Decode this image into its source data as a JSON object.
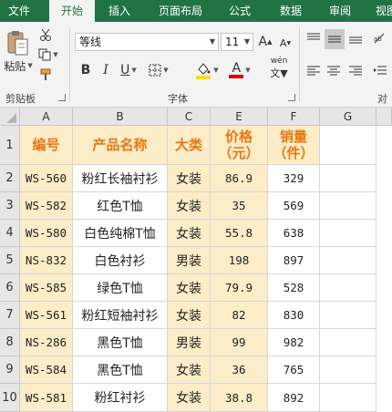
{
  "tabs": [
    "文件",
    "开始",
    "插入",
    "页面布局",
    "公式",
    "数据",
    "审阅",
    "视图"
  ],
  "active_tab": "开始",
  "ribbon": {
    "clipboard": {
      "paste_label": "粘贴",
      "group_label": "剪贴板"
    },
    "font": {
      "font_name": "等线",
      "font_size": "11",
      "grow_label": "A",
      "shrink_label": "A",
      "bold": "B",
      "italic": "I",
      "underline": "U",
      "font_color_label": "A",
      "phonetic_label": "wén",
      "group_label": "字体"
    },
    "alignment": {
      "group_label": "对"
    }
  },
  "columns": [
    "A",
    "B",
    "C",
    "E",
    "F",
    "G"
  ],
  "rows": [
    "1",
    "2",
    "3",
    "4",
    "5",
    "6",
    "7",
    "8",
    "9",
    "10"
  ],
  "header_row": {
    "a": "编号",
    "b": "产品名称",
    "c": "大类",
    "e_line1": "价格",
    "e_line2": "（元）",
    "f_line1": "销量",
    "f_line2": "（件）"
  },
  "data_rows": [
    {
      "a": "WS-560",
      "b": "粉红长袖衬衫",
      "c": "女装",
      "e": "86.9",
      "f": "329"
    },
    {
      "a": "WS-582",
      "b": "红色T恤",
      "c": "女装",
      "e": "35",
      "f": "569"
    },
    {
      "a": "WS-580",
      "b": "白色纯棉T恤",
      "c": "女装",
      "e": "55.8",
      "f": "638"
    },
    {
      "a": "NS-832",
      "b": "白色衬衫",
      "c": "男装",
      "e": "198",
      "f": "897"
    },
    {
      "a": "WS-585",
      "b": "绿色T恤",
      "c": "女装",
      "e": "79.9",
      "f": "528"
    },
    {
      "a": "WS-561",
      "b": "粉红短袖衬衫",
      "c": "女装",
      "e": "82",
      "f": "830"
    },
    {
      "a": "NS-286",
      "b": "黑色T恤",
      "c": "男装",
      "e": "99",
      "f": "982"
    },
    {
      "a": "WS-584",
      "b": "黑色T恤",
      "c": "女装",
      "e": "36",
      "f": "765"
    },
    {
      "a": "WS-581",
      "b": "粉红衬衫",
      "c": "女装",
      "e": "38.8",
      "f": "892"
    }
  ]
}
